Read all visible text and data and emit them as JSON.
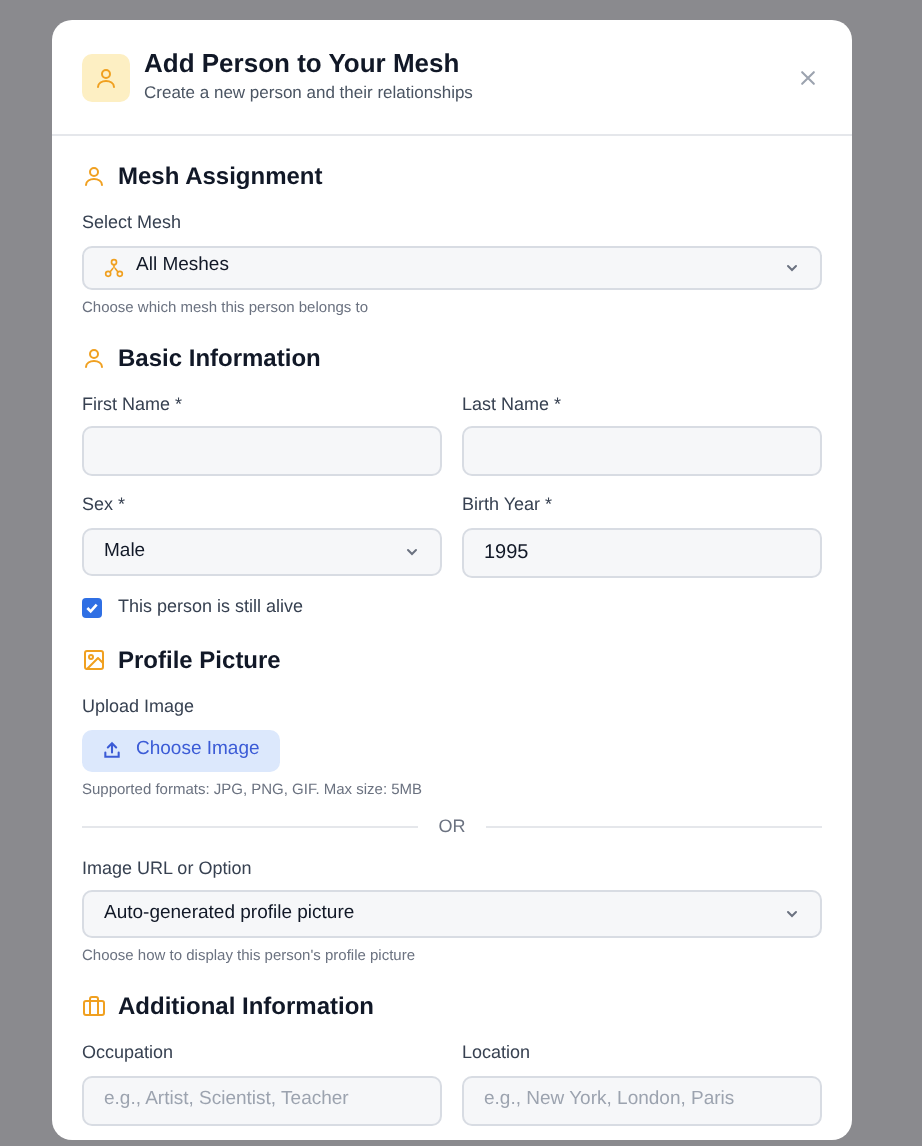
{
  "dialog": {
    "title": "Add Person to Your Mesh",
    "subtitle": "Create a new person and their relationships"
  },
  "mesh_section": {
    "title": "Mesh Assignment",
    "label": "Select Mesh",
    "value": "All Meshes",
    "help": "Choose which mesh this person belongs to"
  },
  "basic_section": {
    "title": "Basic Information",
    "first_name": {
      "label": "First Name *"
    },
    "last_name": {
      "label": "Last Name *"
    },
    "sex": {
      "label": "Sex *",
      "value": "Male"
    },
    "birth_year": {
      "label": "Birth Year *",
      "value": "1995"
    },
    "alive": {
      "label": "This person is still alive",
      "checked": true
    }
  },
  "picture_section": {
    "title": "Profile Picture",
    "upload_label": "Upload Image",
    "upload_button": "Choose Image",
    "formats": "Supported formats: JPG, PNG, GIF. Max size: 5MB",
    "divider": "OR",
    "option_label": "Image URL or Option",
    "option_value": "Auto-generated profile picture",
    "option_help": "Choose how to display this person's profile picture"
  },
  "additional_section": {
    "title": "Additional Information",
    "occupation": {
      "label": "Occupation",
      "placeholder": "e.g., Artist, Scientist, Teacher"
    },
    "location": {
      "label": "Location",
      "placeholder": "e.g., New York, London, Paris"
    }
  }
}
